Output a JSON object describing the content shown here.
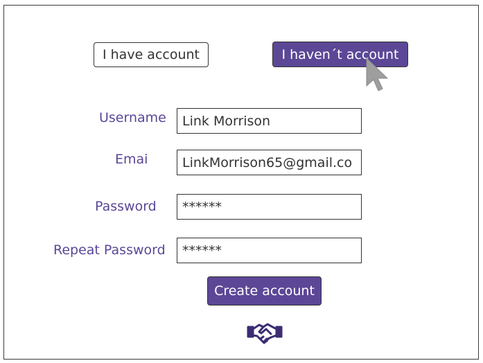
{
  "toggle": {
    "have_account_label": "I have account",
    "no_account_label": "I haven´t account"
  },
  "form": {
    "fields": [
      {
        "label": "Username",
        "value": "Link Morrison"
      },
      {
        "label": "Emai",
        "value": "LinkMorrison65@gmail.co"
      },
      {
        "label": "Password",
        "value": "******"
      },
      {
        "label": "Repeat Password",
        "value": "******"
      }
    ],
    "submit_label": "Create account"
  },
  "icons": {
    "cursor": "mouse-pointer-icon",
    "handshake": "handshake-icon"
  },
  "colors": {
    "accent": "#5b4796",
    "border": "#333333"
  }
}
